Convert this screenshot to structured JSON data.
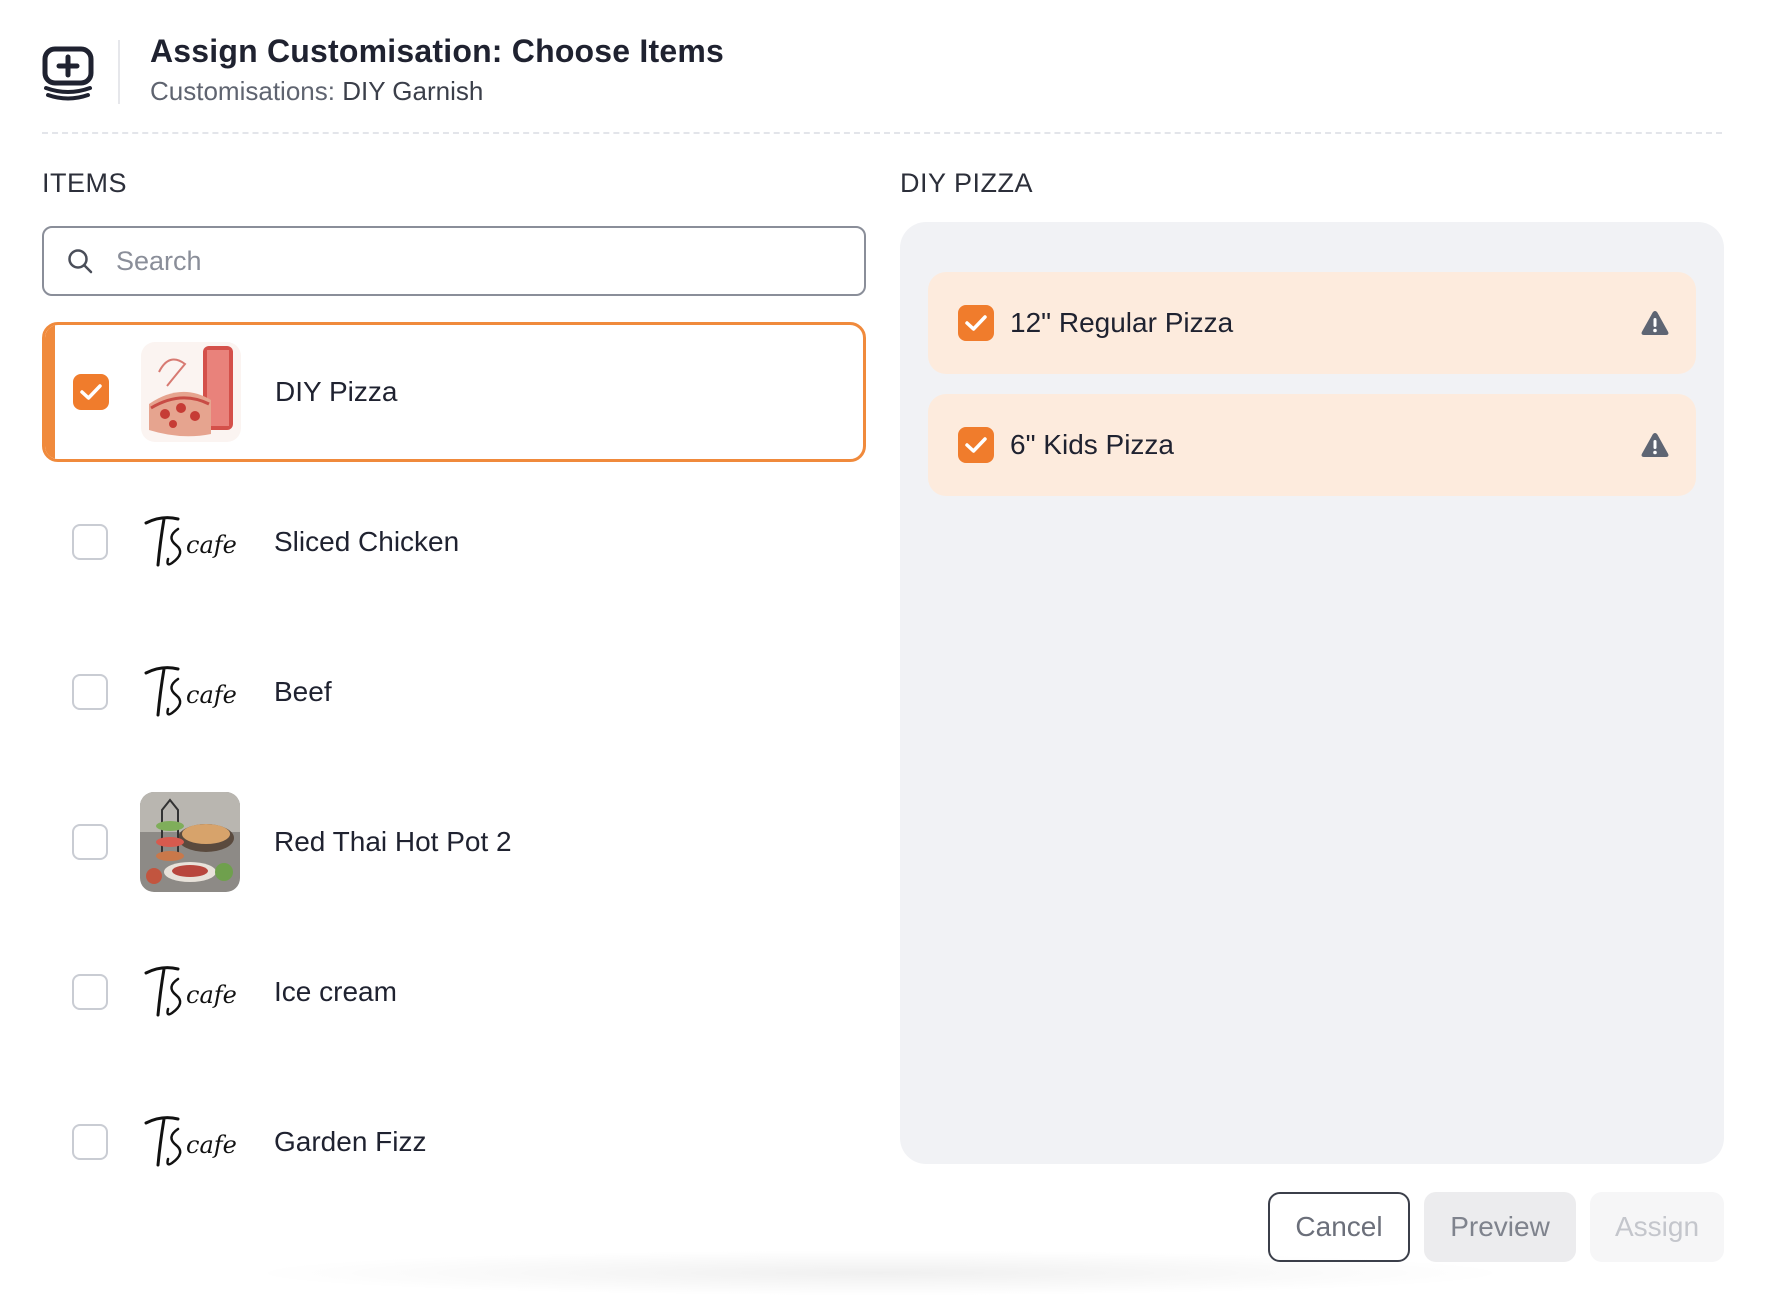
{
  "header": {
    "title": "Assign Customisation: Choose Items",
    "subtitle_label": "Customisations: ",
    "subtitle_value": "DIY Garnish",
    "icon": "add-stack-icon"
  },
  "items_section": {
    "label": "ITEMS",
    "search_placeholder": "Search",
    "items": [
      {
        "name": "DIY Pizza",
        "checked": true,
        "thumb": "pizza-photo"
      },
      {
        "name": "Sliced Chicken",
        "checked": false,
        "thumb": "cafe-logo"
      },
      {
        "name": "Beef",
        "checked": false,
        "thumb": "cafe-logo"
      },
      {
        "name": "Red Thai Hot Pot 2",
        "checked": false,
        "thumb": "hotpot-photo"
      },
      {
        "name": "Ice cream",
        "checked": false,
        "thumb": "cafe-logo"
      },
      {
        "name": "Garden Fizz",
        "checked": false,
        "thumb": "cafe-logo"
      }
    ],
    "logo_text": "TS cafe"
  },
  "detail_section": {
    "label": "DIY PIZZA",
    "variants": [
      {
        "name": "12\" Regular Pizza",
        "checked": true,
        "icon": "warning-icon"
      },
      {
        "name": "6\" Kids Pizza",
        "checked": true,
        "icon": "warning-icon"
      }
    ]
  },
  "footer": {
    "cancel_label": "Cancel",
    "preview_label": "Preview",
    "assign_label": "Assign"
  },
  "colors": {
    "accent": "#f07c2c",
    "variant_bg": "#fdebdd",
    "panel_bg": "#f1f2f5"
  }
}
